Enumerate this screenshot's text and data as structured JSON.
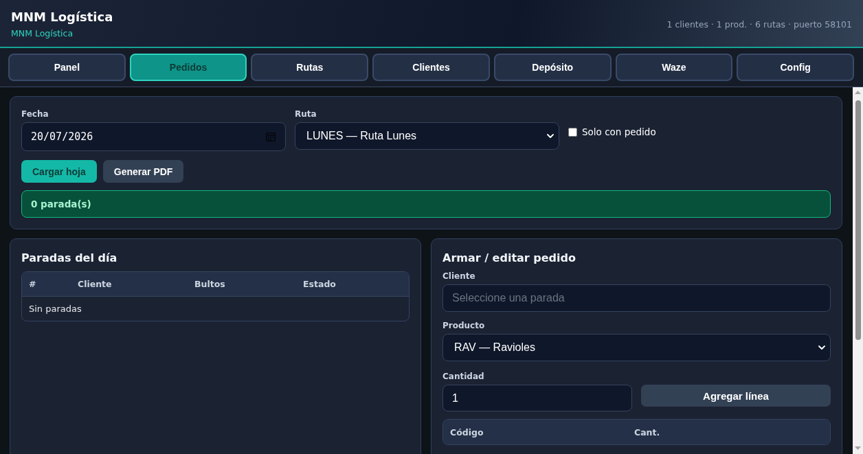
{
  "header": {
    "title": "MNM Logística",
    "subtitle": "MNM Logística",
    "stats": "1 clientes · 1 prod. · 6 rutas · puerto 58101"
  },
  "tabs": [
    {
      "label": "Panel",
      "selected": false
    },
    {
      "label": "Pedidos",
      "selected": true
    },
    {
      "label": "Rutas",
      "selected": false
    },
    {
      "label": "Clientes",
      "selected": false
    },
    {
      "label": "Depósito",
      "selected": false
    },
    {
      "label": "Waze",
      "selected": false
    },
    {
      "label": "Config",
      "selected": false
    }
  ],
  "sheet": {
    "date": {
      "label": "Fecha",
      "value": "20/07/2026"
    },
    "route": {
      "label": "Ruta",
      "value": "LUNES — Ruta Lunes"
    },
    "only_with_order": {
      "label": "Solo con pedido",
      "checked": false
    },
    "buttons": [
      {
        "label": "Cargar hoja",
        "kind": "primary"
      },
      {
        "label": "Generar PDF",
        "kind": "secondary"
      }
    ],
    "status": "0 parada(s)"
  },
  "stops": {
    "title": "Paradas del día",
    "columns": [
      "#",
      "Cliente",
      "Bultos",
      "Estado"
    ],
    "empty_text": "Sin paradas"
  },
  "order": {
    "title": "Armar / editar pedido",
    "client": {
      "label": "Cliente",
      "placeholder": "Seleccione una parada"
    },
    "product": {
      "label": "Producto",
      "value": "RAV — Ravioles"
    },
    "quantity": {
      "label": "Cantidad",
      "value": "1"
    },
    "add_button": {
      "label": "Agregar línea"
    },
    "columns": [
      "Código",
      "Cant."
    ]
  }
}
